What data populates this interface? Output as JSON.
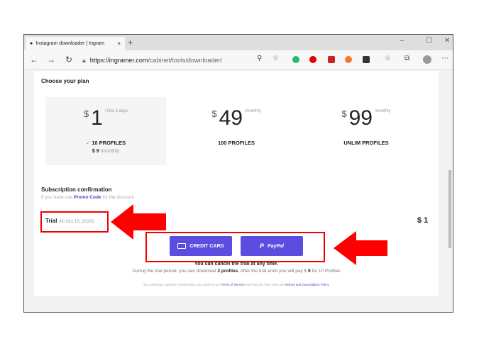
{
  "browser": {
    "tab_title": "Instagram downloader | Ingram",
    "url_host": "https://ingramer.com",
    "url_path": "/cabinet/tools/downloader/"
  },
  "page": {
    "heading": "Choose your plan",
    "plans": [
      {
        "currency": "$",
        "amount": "1",
        "period": "/ first 3 days",
        "profiles": "10 PROFILES",
        "after_price": "$ 9",
        "after_period": "/monthly",
        "selected": true
      },
      {
        "currency": "$",
        "amount": "49",
        "period": "/monthly",
        "profiles": "100 PROFILES",
        "selected": false
      },
      {
        "currency": "$",
        "amount": "99",
        "period": "/monthly",
        "profiles": "UNLIM PROFILES",
        "selected": false
      }
    ],
    "subscription_title": "Subscription confirmation",
    "promo_prefix": "If you have use",
    "promo_link": "Promo Code",
    "promo_suffix": "for the discount",
    "trial_label": "Trial",
    "trial_until": "(till Oct 15, 2020)",
    "total": "$ 1",
    "credit_card_label": "CREDIT CARD",
    "paypal_label": "PayPal",
    "cancel_note": "You can cancel the trial at any time.",
    "trial_info_1": "During the trial period, you can download",
    "trial_info_bold": "2 profiles",
    "trial_info_2": ". After the trial ends you will pay $",
    "trial_info_price": "9",
    "trial_info_3": "for 10 Profiles",
    "legal_1": "By confirming Ingramer membership, you agree to our",
    "terms_link": "Terms of Service",
    "legal_2": "and that you have read our",
    "refund_link": "Refund and Cancellation Policy"
  },
  "colors": {
    "accent": "#5b4de0",
    "annotation": "#e00000"
  }
}
